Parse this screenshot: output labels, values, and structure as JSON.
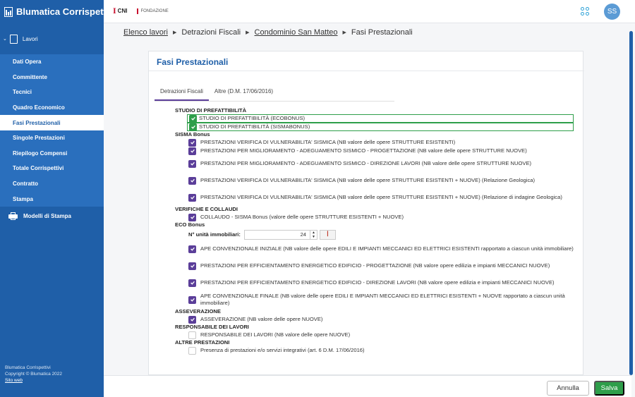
{
  "app": {
    "title": "Blumatica Corrispettivi"
  },
  "header": {
    "logo_cni": "CNI",
    "logo_fondazione": "FONDAZIONE",
    "avatar_initials": "SS"
  },
  "sidebar": {
    "section_label": "Lavori",
    "items": [
      {
        "label": "Dati Opera",
        "active": false
      },
      {
        "label": "Committente",
        "active": false
      },
      {
        "label": "Tecnici",
        "active": false
      },
      {
        "label": "Quadro Economico",
        "active": false
      },
      {
        "label": "Fasi Prestazionali",
        "active": true
      },
      {
        "label": "Singole Prestazioni",
        "active": false
      },
      {
        "label": "Riepilogo Compensi",
        "active": false
      },
      {
        "label": "Totale Corrispettivi",
        "active": false
      },
      {
        "label": "Contratto",
        "active": false
      },
      {
        "label": "Stampa",
        "active": false
      }
    ],
    "modelli_label": "Modelli di Stampa",
    "footer": {
      "line1": "Blumatica Corrispettivi",
      "line2": "Copyright © Blumatica 2022",
      "link": "Sito web"
    }
  },
  "breadcrumb": {
    "b1": "Elenco lavori",
    "b2": "Detrazioni Fiscali",
    "b3": "Condominio San Matteo",
    "b4": "Fasi Prestazionali"
  },
  "card": {
    "title": "Fasi Prestazionali",
    "tabs": {
      "t1": "Detrazioni Fiscali",
      "t2": "Altre (D.M. 17/06/2016)"
    }
  },
  "sections": {
    "s1": "STUDIO DI PREFATTIBILITÀ",
    "s2": "SISMA Bonus",
    "s3": "VERIFICHE E COLLAUDI",
    "s4": "ECO Bonus",
    "s5": "ASSEVERAZIONE",
    "s6": "RESPONSABILE DEI LAVORI",
    "s7": "ALTRE PRESTAZIONI"
  },
  "rows": {
    "r1": "STUDIO DI PREFATTIBILITÀ (ECOBONUS)",
    "r2": "STUDIO DI PREFATTIBILITÀ (SISMABONUS)",
    "r3": "PRESTAZIONI VERIFICA DI VULNERABILITA' SISMICA (NB valore delle opere STRUTTURE ESISTENTI)",
    "r4": "PRESTAZIONI PER MIGLIORAMENTO - ADEGUAMENTO SISMICO - PROGETTAZIONE (NB valore delle opere STRUTTURE NUOVE)",
    "r5": "PRESTAZIONI PER MIGLIORAMENTO - ADEGUAMENTO SISMICO - DIREZIONE LAVORI (NB valore delle opere STRUTTURE NUOVE)",
    "r6": "PRESTAZIONI VERIFICA DI VULNERABILITA' SISMICA (NB valore delle opere STRUTTURE ESISTENTI + NUOVE) (Relazione Geologica)",
    "r7": "PRESTAZIONI VERIFICA DI VULNERABILITA' SISMICA (NB valore delle opere STRUTTURE ESISTENTI + NUOVE) (Relazione di indagine Geologica)",
    "r8": "COLLAUDO - SISMA Bonus (valore delle opere STRUTTURE ESISTENTI + NUOVE)",
    "r9": "APE CONVENZIONALE INIZIALE (NB valore delle opere EDILI E IMPIANTI MECCANICI ED ELETTRICI ESISTENTI rapportato a ciascun unità immobiliare)",
    "r10": "PRESTAZIONI PER EFFICIENTAMENTO ENERGETICO EDIFICIO - PROGETTAZIONE (NB valore opere edilizia e impianti MECCANICI NUOVE)",
    "r11": "PRESTAZIONI PER EFFICIENTAMENTO ENERGETICO EDIFICIO - DIREZIONE LAVORI (NB valore opere edilizia e impianti MECCANICI NUOVE)",
    "r12": "APE CONVENZIONALE FINALE (NB valore delle opere EDILI E IMPIANTI MECCANICI ED ELETTRICI ESISTENTI + NUOVE rapportato a ciascun unità immobiliare)",
    "r13": "ASSEVERAZIONE (NB valore delle opere NUOVE)",
    "r14": "RESPONSABILE DEI LAVORI (NB valore delle opere NUOVE)",
    "r15": "Presenza di prestazioni e/o servizi integrativi (art. 6 D.M. 17/06/2016)"
  },
  "units": {
    "label": "N° unità immobiliari:",
    "value": "24"
  },
  "buttons": {
    "annulla": "Annulla",
    "salva": "Salva"
  },
  "colors": {
    "sidebar": "#1f5fa8",
    "checkbox": "#5b3e99",
    "success": "#2e9e4a"
  }
}
